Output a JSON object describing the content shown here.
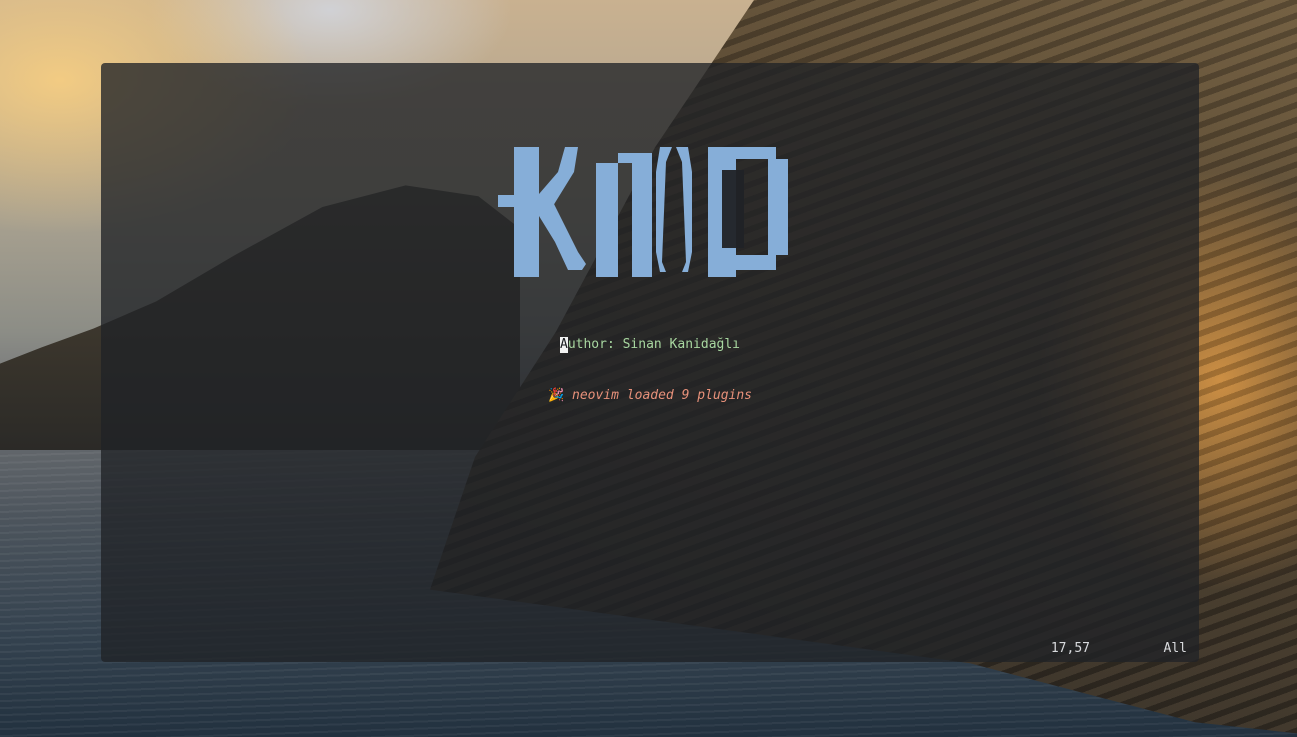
{
  "logo": {
    "text": "KNID",
    "color": "#86aed8"
  },
  "dashboard": {
    "author_first_char": "A",
    "author_rest": "uthor: Sinan Kanidağlı",
    "loaded_icon": "party-popper-icon",
    "loaded_icon_glyph": "🎉",
    "loaded_text": "neovim loaded 9 plugins"
  },
  "statusline": {
    "position": "17,57",
    "scroll": "All"
  },
  "colors": {
    "author": "#a8d7a0",
    "loaded": "#e8917a",
    "status_text": "#d8dadd",
    "cursor_bg": "#f2f2f2"
  }
}
